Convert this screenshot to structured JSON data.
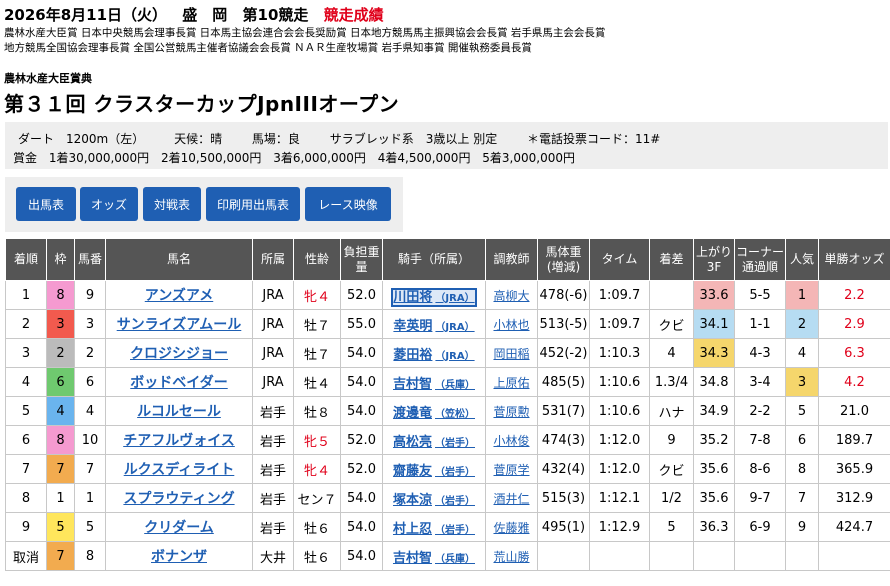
{
  "header": {
    "date": "2026年8月11日（火）",
    "venue": "盛　岡",
    "race_no": "第10競走",
    "status": "競走成績",
    "sponsors_line1": "農林水産大臣賞 日本中央競馬会理事長賞 日本馬主協会連合会会長奨励賞 日本地方競馬馬主振興協会会長賞 岩手県馬主会会長賞",
    "sponsors_line2": "地方競馬全国協会理事長賞 全国公営競馬主催者協議会会長賞 ＮＡＲ生産牧場賞 岩手県知事賞 開催執務委員長賞",
    "race_subtitle": "農林水産大臣賞典",
    "race_name": "第３１回 クラスターカップJpnIIIオープン"
  },
  "info": {
    "distance": "ダート　1200m（左）",
    "weather": "天候：晴",
    "track": "馬場：良",
    "conditions": "サラブレッド系　3歳以上 別定",
    "code": "＊電話投票コード：11#",
    "prize_label": "賞金",
    "prizes": [
      "1着30,000,000円",
      "2着10,500,000円",
      "3着6,000,000円",
      "4着4,500,000円",
      "5着3,000,000円"
    ]
  },
  "buttons": [
    "出馬表",
    "オッズ",
    "対戦表",
    "印刷用出馬表",
    "レース映像"
  ],
  "table": {
    "headers": [
      "着順",
      "枠",
      "馬番",
      "馬名",
      "所属",
      "性齢",
      "負担重量",
      "騎手（所属）",
      "調教師",
      "馬体重(増減)",
      "タイム",
      "着差",
      "上がり3F",
      "コーナー通過順",
      "人気",
      "単勝オッズ"
    ],
    "rows": [
      {
        "rank": "1",
        "waku": "8",
        "num": "9",
        "name": "アンズアメ",
        "aff": "JRA",
        "sex": "牝４",
        "wt": "52.0",
        "jockey": "川田将",
        "jaff": "（JRA）",
        "trainer": "高柳大",
        "body": "478(-6)",
        "time": "1:09.7",
        "margin": "",
        "last3f": "33.6",
        "corner": "5-5",
        "pop": "1",
        "odds": "2.2"
      },
      {
        "rank": "2",
        "waku": "3",
        "num": "3",
        "name": "サンライズアムール",
        "aff": "JRA",
        "sex": "牡７",
        "wt": "55.0",
        "jockey": "幸英明",
        "jaff": "（JRA）",
        "trainer": "小林也",
        "body": "513(-5)",
        "time": "1:09.7",
        "margin": "クビ",
        "last3f": "34.1",
        "corner": "1-1",
        "pop": "2",
        "odds": "2.9"
      },
      {
        "rank": "3",
        "waku": "2",
        "num": "2",
        "name": "クロジシジョー",
        "aff": "JRA",
        "sex": "牡７",
        "wt": "54.0",
        "jockey": "菱田裕",
        "jaff": "（JRA）",
        "trainer": "岡田稲",
        "body": "452(-2)",
        "time": "1:10.3",
        "margin": "4",
        "last3f": "34.3",
        "corner": "4-3",
        "pop": "4",
        "odds": "6.3"
      },
      {
        "rank": "4",
        "waku": "6",
        "num": "6",
        "name": "ボッドベイダー",
        "aff": "JRA",
        "sex": "牡４",
        "wt": "54.0",
        "jockey": "吉村智",
        "jaff": "（兵庫）",
        "trainer": "上原佑",
        "body": "485(5)",
        "time": "1:10.6",
        "margin": "1.3/4",
        "last3f": "34.8",
        "corner": "3-4",
        "pop": "3",
        "odds": "4.2"
      },
      {
        "rank": "5",
        "waku": "4",
        "num": "4",
        "name": "ルコルセール",
        "aff": "岩手",
        "sex": "牡８",
        "wt": "54.0",
        "jockey": "渡邊竜",
        "jaff": "（笠松）",
        "trainer": "菅原勲",
        "body": "531(7)",
        "time": "1:10.6",
        "margin": "ハナ",
        "last3f": "34.9",
        "corner": "2-2",
        "pop": "5",
        "odds": "21.0"
      },
      {
        "rank": "6",
        "waku": "8",
        "num": "10",
        "name": "チアフルヴォイス",
        "aff": "岩手",
        "sex": "牝５",
        "wt": "52.0",
        "jockey": "高松亮",
        "jaff": "（岩手）",
        "trainer": "小林俊",
        "body": "474(3)",
        "time": "1:12.0",
        "margin": "9",
        "last3f": "35.2",
        "corner": "7-8",
        "pop": "6",
        "odds": "189.7"
      },
      {
        "rank": "7",
        "waku": "7",
        "num": "7",
        "name": "ルクスディライト",
        "aff": "岩手",
        "sex": "牝４",
        "wt": "52.0",
        "jockey": "齋藤友",
        "jaff": "（岩手）",
        "trainer": "菅原学",
        "body": "432(4)",
        "time": "1:12.0",
        "margin": "クビ",
        "last3f": "35.6",
        "corner": "8-6",
        "pop": "8",
        "odds": "365.9"
      },
      {
        "rank": "8",
        "waku": "1",
        "num": "1",
        "name": "スプラウティング",
        "aff": "岩手",
        "sex": "セン７",
        "wt": "54.0",
        "jockey": "塚本涼",
        "jaff": "（岩手）",
        "trainer": "酒井仁",
        "body": "515(3)",
        "time": "1:12.1",
        "margin": "1/2",
        "last3f": "35.6",
        "corner": "9-7",
        "pop": "7",
        "odds": "312.9"
      },
      {
        "rank": "9",
        "waku": "5",
        "num": "5",
        "name": "クリダーム",
        "aff": "岩手",
        "sex": "牡６",
        "wt": "54.0",
        "jockey": "村上忍",
        "jaff": "（岩手）",
        "trainer": "佐藤雅",
        "body": "495(1)",
        "time": "1:12.9",
        "margin": "5",
        "last3f": "36.3",
        "corner": "6-9",
        "pop": "9",
        "odds": "424.7"
      },
      {
        "rank": "取消",
        "waku": "7",
        "num": "8",
        "name": "ボナンザ",
        "aff": "大井",
        "sex": "牡６",
        "wt": "54.0",
        "jockey": "吉村智",
        "jaff": "（兵庫）",
        "trainer": "荒山勝",
        "body": "",
        "time": "",
        "margin": "",
        "last3f": "",
        "corner": "",
        "pop": "",
        "odds": ""
      }
    ]
  },
  "colors": {
    "waku": {
      "1": "#ffffff",
      "2": "#bbbbbb",
      "3": "#f25a4e",
      "4": "#6ab4ee",
      "5": "#ffe65c",
      "6": "#6fc96f",
      "7": "#f2ab4f",
      "8": "#f59ad0"
    },
    "rank1_bg": "#f4b6b6",
    "rank2_bg": "#b6dcf2",
    "rank3_bg": "#f5d66c",
    "link": "#1f5fb3",
    "header_bg": "#555555",
    "accent_red": "#e0001a"
  }
}
